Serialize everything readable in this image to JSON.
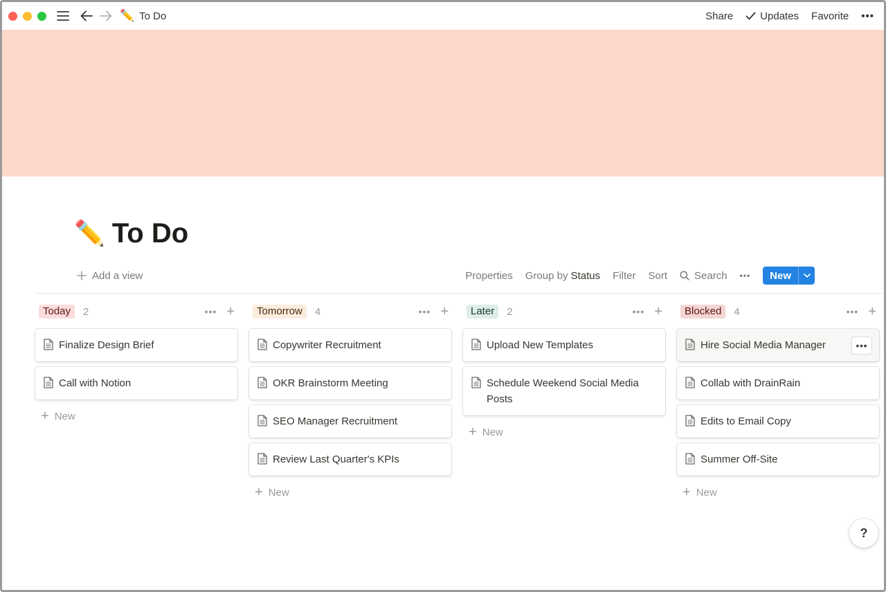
{
  "topbar": {
    "page_emoji": "✏️",
    "page_title": "To Do",
    "share_label": "Share",
    "updates_label": "Updates",
    "favorite_label": "Favorite",
    "more_label": "•••"
  },
  "page": {
    "emoji": "✏️",
    "title": "To Do",
    "cover_color": "#fdd9cc"
  },
  "viewbar": {
    "add_view_label": "Add a view",
    "properties_label": "Properties",
    "group_by_prefix": "Group by",
    "group_by_value": "Status",
    "filter_label": "Filter",
    "sort_label": "Sort",
    "search_label": "Search",
    "more_label": "•••",
    "new_label": "New"
  },
  "columns": [
    {
      "label": "Today",
      "count": "2",
      "tag_bg": "#fbdcdc",
      "tag_fg": "#5d1715",
      "cards": [
        "Finalize Design Brief",
        "Call with Notion"
      ],
      "new_label": "New"
    },
    {
      "label": "Tomorrow",
      "count": "4",
      "tag_bg": "#fbecdd",
      "tag_fg": "#49290e",
      "cards": [
        "Copywriter Recruitment",
        "OKR Brainstorm Meeting",
        "SEO Manager Recruitment",
        "Review Last Quarter's KPIs"
      ],
      "new_label": "New"
    },
    {
      "label": "Later",
      "count": "2",
      "tag_bg": "#ddedea",
      "tag_fg": "#1c3829",
      "cards": [
        "Upload New Templates",
        "Schedule Weekend Social Media Posts"
      ],
      "new_label": "New"
    },
    {
      "label": "Blocked",
      "count": "4",
      "tag_bg": "#f4d6d4",
      "tag_fg": "#5d1715",
      "cards": [
        "Hire Social Media Manager",
        "Collab with DrainRain",
        "Edits to Email Copy",
        "Summer Off-Site"
      ],
      "new_label": "New"
    }
  ],
  "card_menu_label": "•••",
  "help_label": "?"
}
